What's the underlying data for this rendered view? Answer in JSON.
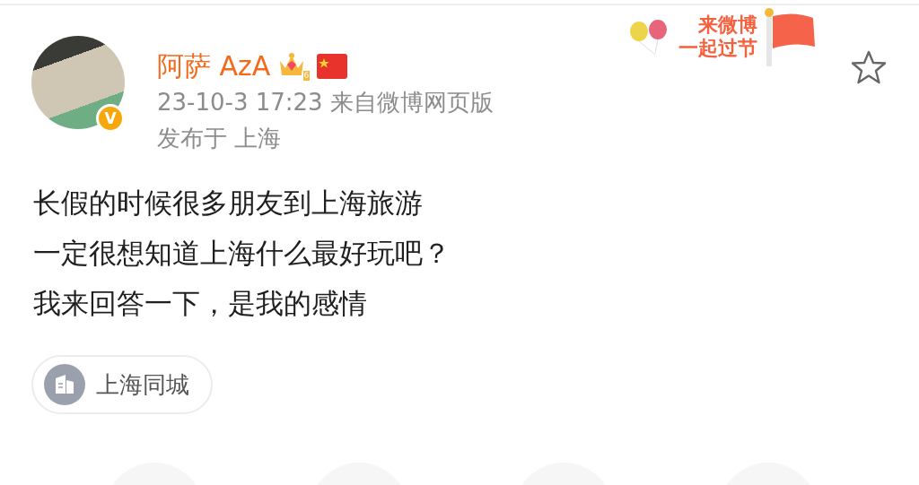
{
  "post": {
    "author": {
      "name": "阿萨 AzA",
      "verified_mark": "V",
      "vip_level": "6"
    },
    "time": "23-10-3 17:23",
    "source": "来自微博网页版",
    "location": "发布于 上海",
    "banner": {
      "lines": [
        "来微博",
        "一起过节"
      ]
    },
    "favorited": false,
    "body_lines": [
      "长假的时候很多朋友到上海旅游",
      "一定很想知道上海什么最好玩吧？",
      "我来回答一下，是我的感情"
    ],
    "topic_chip": {
      "label": "上海同城"
    }
  }
}
